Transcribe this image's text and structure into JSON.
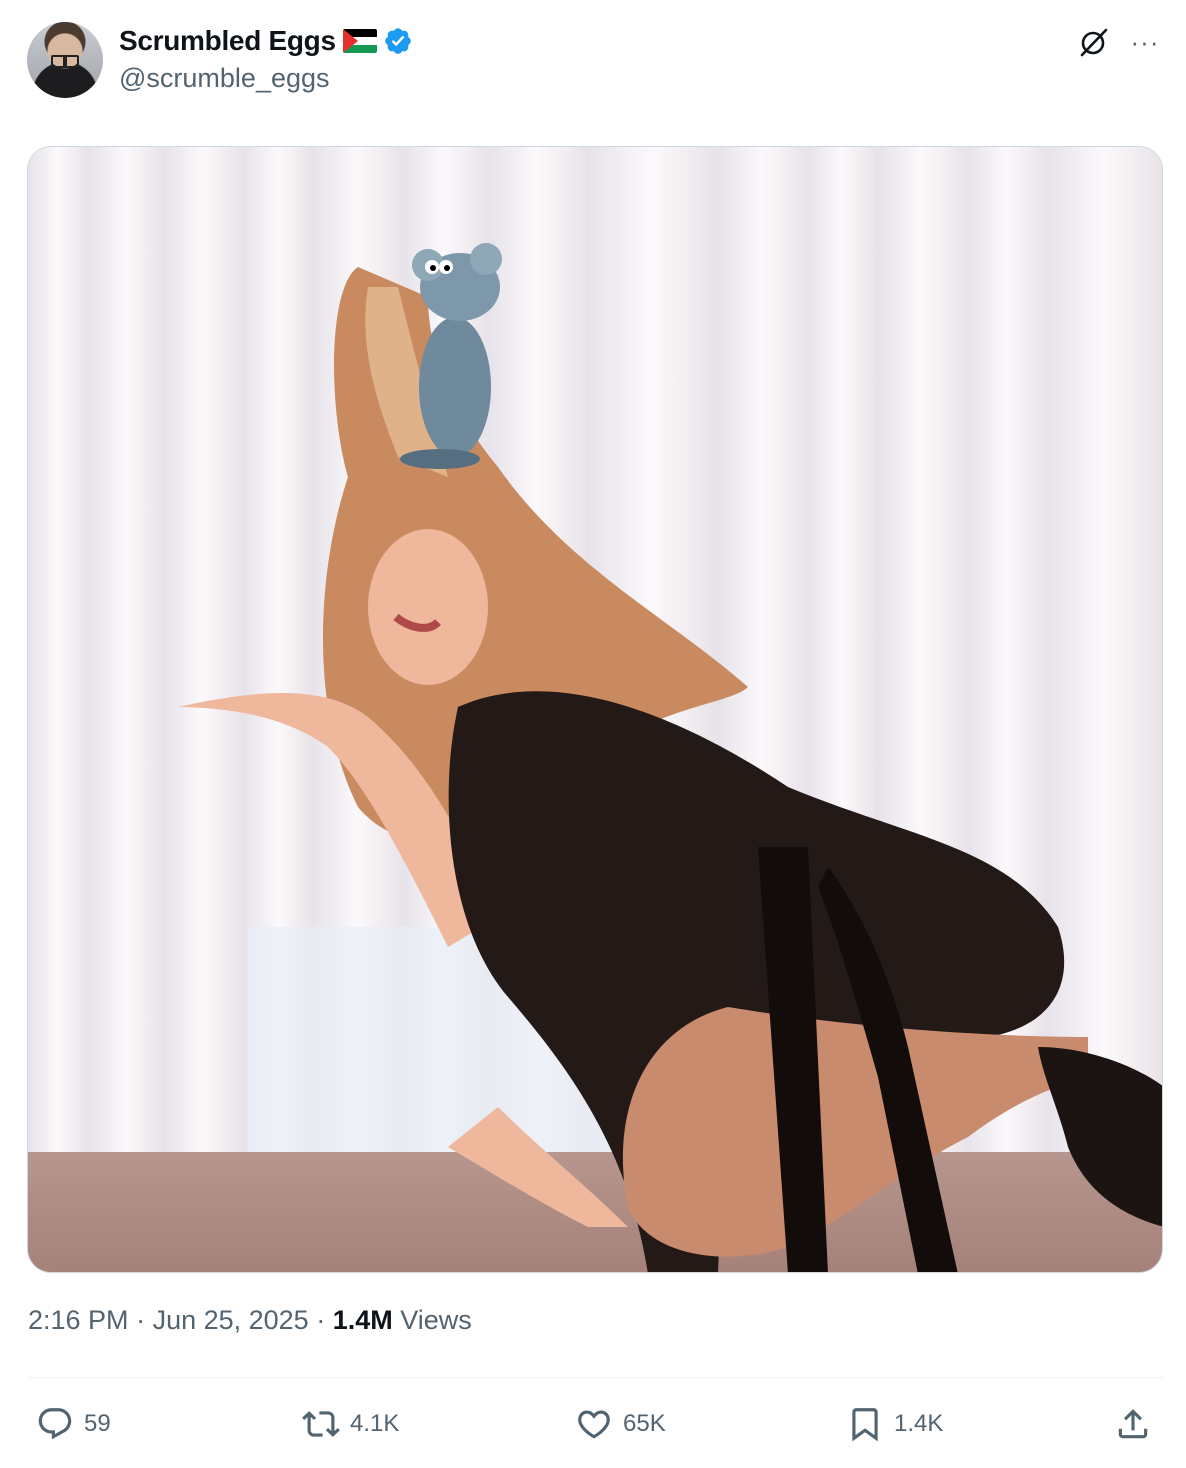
{
  "author": {
    "display_name": "Scrumbled Eggs",
    "handle": "@scrumble_eggs",
    "flag_icon": "palestine-flag-icon",
    "verified_icon": "verified-badge-icon",
    "verified_color": "#1d9bf0"
  },
  "header_icons": {
    "grok": "grok-icon",
    "more": "more-options-icon",
    "more_glyph": "···"
  },
  "media": {
    "kind": "photo"
  },
  "meta": {
    "time": "2:16 PM",
    "sep1": " · ",
    "date": "Jun 25, 2025",
    "sep2": " · ",
    "views_count": "1.4M",
    "views_label": " Views"
  },
  "actions": {
    "reply": {
      "icon": "reply-icon",
      "count": "59"
    },
    "retweet": {
      "icon": "retweet-icon",
      "count": "4.1K"
    },
    "like": {
      "icon": "heart-icon",
      "count": "65K"
    },
    "bookmark": {
      "icon": "bookmark-icon",
      "count": "1.4K"
    },
    "share": {
      "icon": "share-icon"
    }
  },
  "colors": {
    "text_primary": "#0f1419",
    "text_secondary": "#536471",
    "border": "#cfd9de"
  }
}
